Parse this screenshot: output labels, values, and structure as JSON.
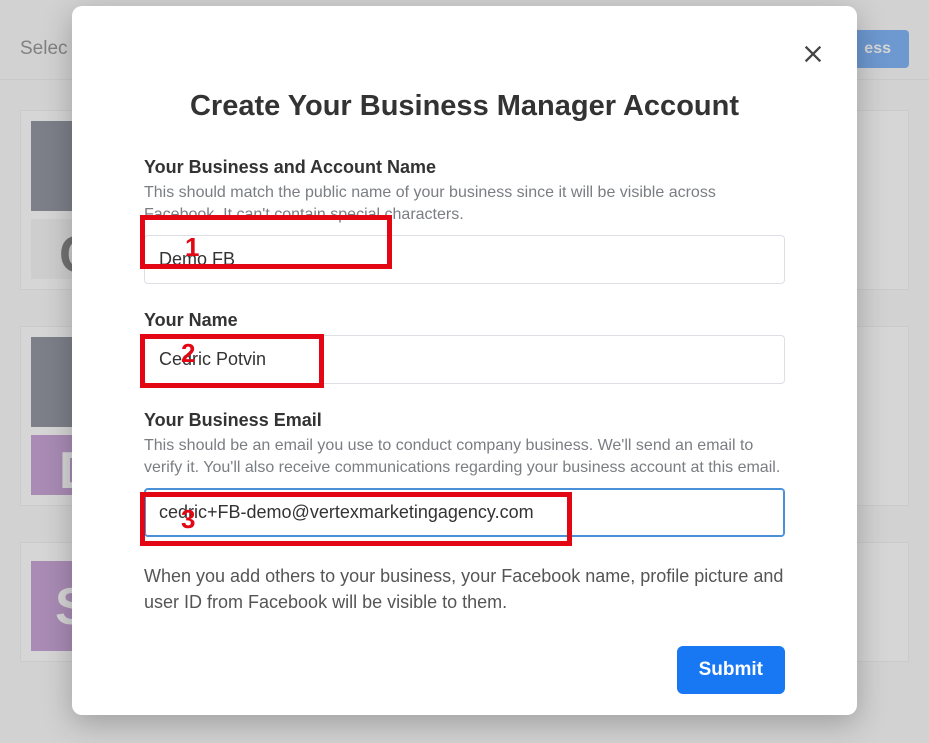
{
  "background": {
    "select_label": "Selec",
    "primary_button": "ess"
  },
  "modal": {
    "title": "Create Your Business Manager Account",
    "close_aria": "Close",
    "fields": {
      "business_name": {
        "label": "Your Business and Account Name",
        "hint": "This should match the public name of your business since it will be visible across Facebook. It can't contain special characters.",
        "value": "Demo FB"
      },
      "your_name": {
        "label": "Your Name",
        "value": "Cedric Potvin"
      },
      "business_email": {
        "label": "Your Business Email",
        "hint": "This should be an email you use to conduct company business. We'll send an email to verify it. You'll also receive communications regarding your business account at this email.",
        "value": "cedric+FB-demo@vertexmarketingagency.com"
      }
    },
    "disclosure": "When you add others to your business, your Facebook name, profile picture and user ID from Facebook will be visible to them.",
    "submit": "Submit"
  },
  "annotations": {
    "n1": "1",
    "n2": "2",
    "n3": "3"
  }
}
